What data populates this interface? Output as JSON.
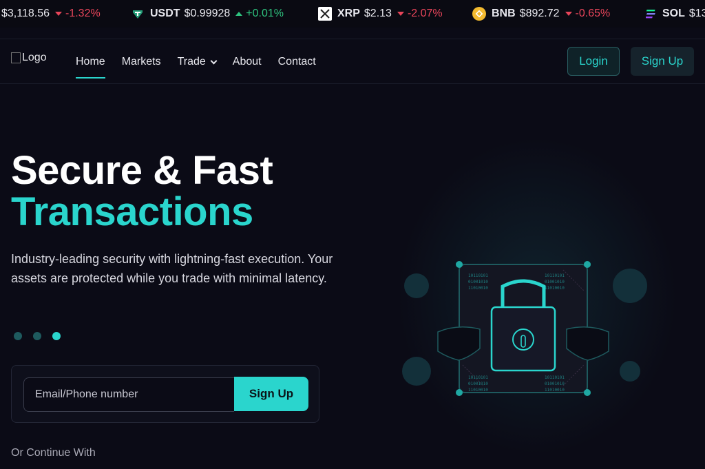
{
  "ticker": [
    {
      "symbol": "",
      "price": "$3,118.56",
      "change": "-1.32%",
      "direction": "down",
      "icon": "none",
      "color": ""
    },
    {
      "symbol": "USDT",
      "price": "$0.99928",
      "change": "+0.01%",
      "direction": "up",
      "icon": "tether-icon",
      "color": "#26a17b"
    },
    {
      "symbol": "XRP",
      "price": "$2.13",
      "change": "-2.07%",
      "direction": "down",
      "icon": "xrp-icon",
      "color": "#ffffff"
    },
    {
      "symbol": "BNB",
      "price": "$892.72",
      "change": "-0.65%",
      "direction": "down",
      "icon": "bnb-icon",
      "color": "#f3ba2f"
    },
    {
      "symbol": "SOL",
      "price": "$13",
      "change": "",
      "direction": "",
      "icon": "solana-icon",
      "color": "#9945ff"
    }
  ],
  "header": {
    "logo_alt": "Logo",
    "nav": [
      {
        "label": "Home",
        "active": true
      },
      {
        "label": "Markets"
      },
      {
        "label": "Trade",
        "dropdown": true
      },
      {
        "label": "About"
      },
      {
        "label": "Contact"
      }
    ],
    "login_label": "Login",
    "signup_label": "Sign Up"
  },
  "hero": {
    "title_line1": "Secure & Fast",
    "title_line2": "Transactions",
    "description": "Industry-leading security with lightning-fast execution. Your assets are protected while you trade with minimal latency.",
    "slides_total": 3,
    "slide_active": 3
  },
  "form": {
    "email_placeholder": "Email/Phone number",
    "signup_label": "Sign Up"
  },
  "continue_label": "Or Continue With",
  "illustration": {
    "binary_tl": [
      "10110101",
      "01001010",
      "11010010"
    ],
    "binary_tr": [
      "10110101",
      "01001010",
      "11010010"
    ],
    "binary_bl": [
      "10110101",
      "01001010",
      "11010010"
    ],
    "binary_br": [
      "10110101",
      "01001010",
      "11010010"
    ]
  },
  "colors": {
    "accent": "#2ad5cd",
    "negative": "#e8455a",
    "positive": "#2ec27e",
    "background": "#0b0b16"
  }
}
